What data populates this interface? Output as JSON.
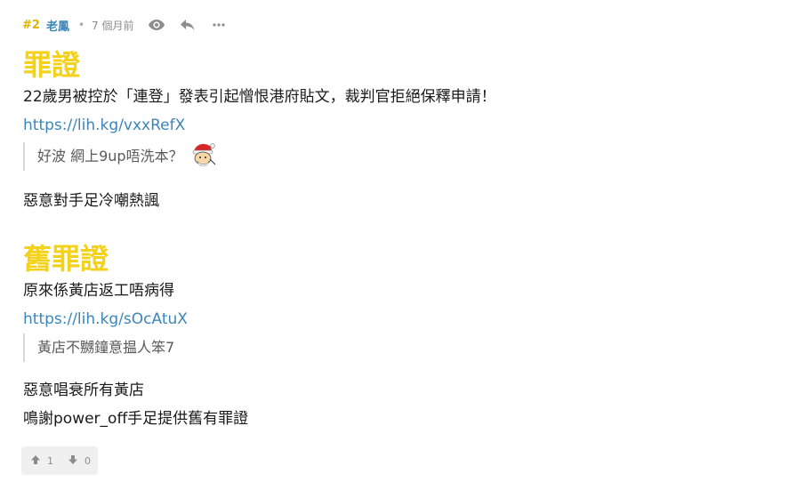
{
  "post": {
    "floor": "#2",
    "author": "老鳳",
    "separator": "•",
    "time": "7 個月前",
    "icons": {
      "view": "eye-icon",
      "reply": "reply-icon",
      "more": "more-icon"
    },
    "more_label": "···"
  },
  "content": {
    "heading1": "罪證",
    "line1": "22歲男被控於「連登」發表引起憎恨港府貼文，裁判官拒絕保釋申請！",
    "link1": "https://lih.kg/vxxRefX",
    "quote1": "好波 網上9up唔洗本？",
    "emoji1": "santa-face-emoji",
    "line2": "惡意對手足冷嘲熱諷",
    "heading2": "舊罪證",
    "line3": "原來係黃店返工唔病得",
    "link2": "https://lih.kg/sOcAtuX",
    "quote2": "黃店不嬲鐘意揾人笨7",
    "line4": "惡意唱衰所有黃店",
    "line5": "鳴謝power_off手足提供舊有罪證"
  },
  "votes": {
    "up_count": "1",
    "down_count": "0",
    "up_icon": "thumbs-up-icon",
    "down_icon": "thumbs-down-icon"
  },
  "colors": {
    "floor": "#e0b400",
    "author": "#3c86b8",
    "heading": "#f4d21c",
    "link": "#3c86b8"
  }
}
